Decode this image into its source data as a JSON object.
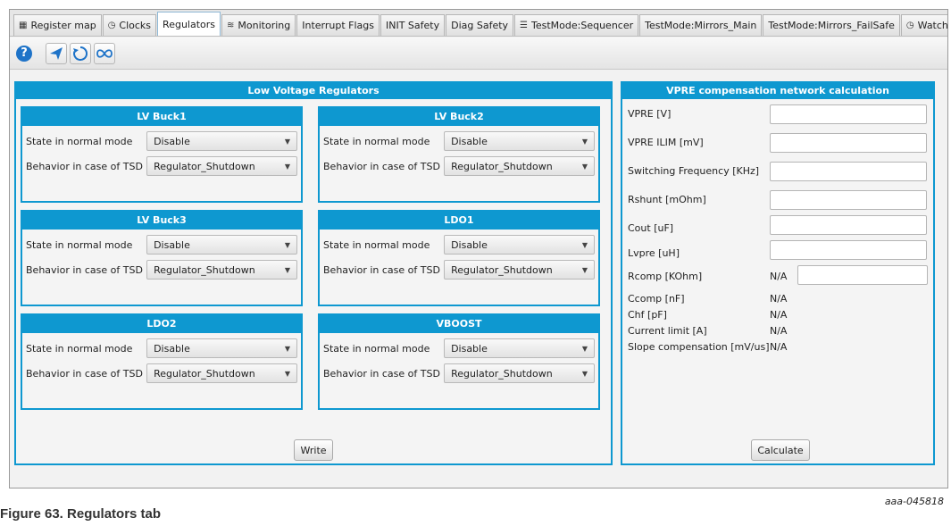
{
  "tabs": [
    {
      "label": "Register map",
      "icon": "register-map-icon",
      "glyph": "▦"
    },
    {
      "label": "Clocks",
      "icon": "clock-icon",
      "glyph": "◷"
    },
    {
      "label": "Regulators",
      "icon": "",
      "glyph": "",
      "active": true
    },
    {
      "label": "Monitoring",
      "icon": "monitoring-icon",
      "glyph": "≋"
    },
    {
      "label": "Interrupt Flags",
      "icon": "",
      "glyph": ""
    },
    {
      "label": "INIT Safety",
      "icon": "",
      "glyph": ""
    },
    {
      "label": "Diag Safety",
      "icon": "",
      "glyph": ""
    },
    {
      "label": "TestMode:Sequencer",
      "icon": "sequencer-icon",
      "glyph": "☰"
    },
    {
      "label": "TestMode:Mirrors_Main",
      "icon": "",
      "glyph": ""
    },
    {
      "label": "TestMode:Mirrors_FailSafe",
      "icon": "",
      "glyph": ""
    },
    {
      "label": "WatchD",
      "icon": "clock-icon",
      "glyph": "◷"
    }
  ],
  "toolbar": {
    "help_glyph": "?",
    "buttons": [
      "help-icon",
      "send-icon",
      "refresh-icon",
      "infinity-icon"
    ]
  },
  "lv_regulators": {
    "title": "Low Voltage Regulators",
    "state_label": "State in normal mode",
    "tsd_label": "Behavior in case of TSD",
    "blocks": [
      {
        "title": "LV Buck1",
        "state": "Disable",
        "tsd": "Regulator_Shutdown"
      },
      {
        "title": "LV Buck2",
        "state": "Disable",
        "tsd": "Regulator_Shutdown"
      },
      {
        "title": "LV Buck3",
        "state": "Disable",
        "tsd": "Regulator_Shutdown"
      },
      {
        "title": "LDO1",
        "state": "Disable",
        "tsd": "Regulator_Shutdown"
      },
      {
        "title": "LDO2",
        "state": "Disable",
        "tsd": "Regulator_Shutdown"
      },
      {
        "title": "VBOOST",
        "state": "Disable",
        "tsd": "Regulator_Shutdown"
      }
    ],
    "write_label": "Write"
  },
  "vpre": {
    "title": "VPRE compensation network calculation",
    "inputs": [
      {
        "label": "VPRE [V]",
        "value": ""
      },
      {
        "label": "VPRE ILIM [mV]",
        "value": ""
      },
      {
        "label": "Switching Frequency [KHz]",
        "value": ""
      },
      {
        "label": "Rshunt [mOhm]",
        "value": ""
      },
      {
        "label": "Cout [uF]",
        "value": ""
      },
      {
        "label": "Lvpre [uH]",
        "value": ""
      }
    ],
    "rcomp": {
      "label": "Rcomp [KOhm]",
      "value": "N/A",
      "input": ""
    },
    "results": [
      {
        "label": "Ccomp [nF]",
        "value": "N/A"
      },
      {
        "label": "Chf [pF]",
        "value": "N/A"
      },
      {
        "label": "Current limit [A]",
        "value": "N/A"
      },
      {
        "label": "Slope compensation [mV/us]",
        "value": "N/A"
      }
    ],
    "calculate_label": "Calculate"
  },
  "figure_tag": "aaa-045818",
  "caption": "Figure 63.  Regulators tab",
  "colors": {
    "accent": "#0e98d0",
    "help": "#1e73c8"
  }
}
